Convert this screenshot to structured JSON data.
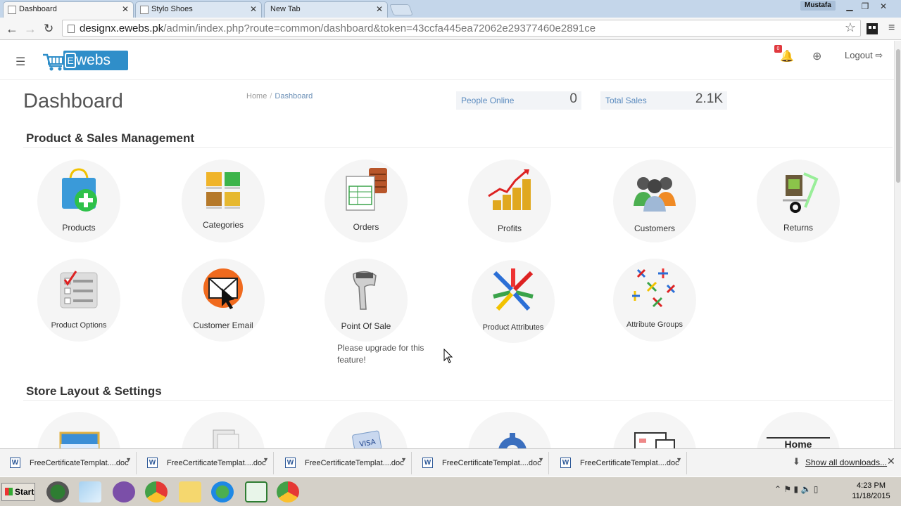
{
  "browser": {
    "tabs": [
      {
        "label": "Dashboard",
        "active": true
      },
      {
        "label": "Stylo Shoes",
        "active": false
      },
      {
        "label": "New Tab",
        "active": false
      }
    ],
    "user": "Mustafa",
    "url_host": "designx.ewebs.pk",
    "url_path": "/admin/index.php?route=common/dashboard&token=43ccfa445ea72062e29377460e2891ce"
  },
  "header": {
    "logo_text": "webs",
    "logo_letter": "E",
    "notification_count": "0",
    "logout_label": "Logout"
  },
  "page": {
    "title": "Dashboard",
    "breadcrumb": [
      "Home",
      "Dashboard"
    ],
    "stats": [
      {
        "label": "People Online",
        "value": "0"
      },
      {
        "label": "Total Sales",
        "value": "2.1K"
      }
    ]
  },
  "sections": [
    {
      "title": "Product & Sales Management",
      "tiles": [
        {
          "label": "Products",
          "icon": "shopping-bag-plus-icon"
        },
        {
          "label": "Categories",
          "icon": "categories-grid-icon"
        },
        {
          "label": "Orders",
          "icon": "order-form-icon"
        },
        {
          "label": "Profits",
          "icon": "coins-chart-icon"
        },
        {
          "label": "Customers",
          "icon": "people-group-icon"
        },
        {
          "label": "Returns",
          "icon": "hand-truck-icon"
        },
        {
          "label": "Product Options",
          "icon": "checklist-icon"
        },
        {
          "label": "Customer Email",
          "icon": "email-icon"
        },
        {
          "label": "Point Of Sale",
          "icon": "barcode-scanner-icon"
        },
        {
          "label": "Product Attributes",
          "icon": "attributes-star-icon"
        },
        {
          "label": "Attribute Groups",
          "icon": "attribute-groups-icon"
        }
      ],
      "upgrade_note": "Please upgrade for this feature!"
    },
    {
      "title": "Store Layout & Settings",
      "tiles": [
        {
          "label": "",
          "icon": "banner-image-icon"
        },
        {
          "label": "",
          "icon": "document-icon"
        },
        {
          "label": "",
          "icon": "visa-card-icon"
        },
        {
          "label": "",
          "icon": "gear-icon"
        },
        {
          "label": "",
          "icon": "monitor-icon"
        },
        {
          "label": "Home",
          "icon": "home-layout-icon"
        }
      ]
    }
  ],
  "downloads": {
    "items": [
      "FreeCertificateTemplat....doc",
      "FreeCertificateTemplat....doc",
      "FreeCertificateTemplat....doc",
      "FreeCertificateTemplat....doc",
      "FreeCertificateTemplat....doc"
    ],
    "show_all": "Show all downloads..."
  },
  "taskbar": {
    "start_label": "Start",
    "time": "4:23 PM",
    "date": "11/18/2015"
  },
  "colors": {
    "accent": "#2f8ec9",
    "link": "#5b8bbf",
    "badge": "#e0393e"
  }
}
